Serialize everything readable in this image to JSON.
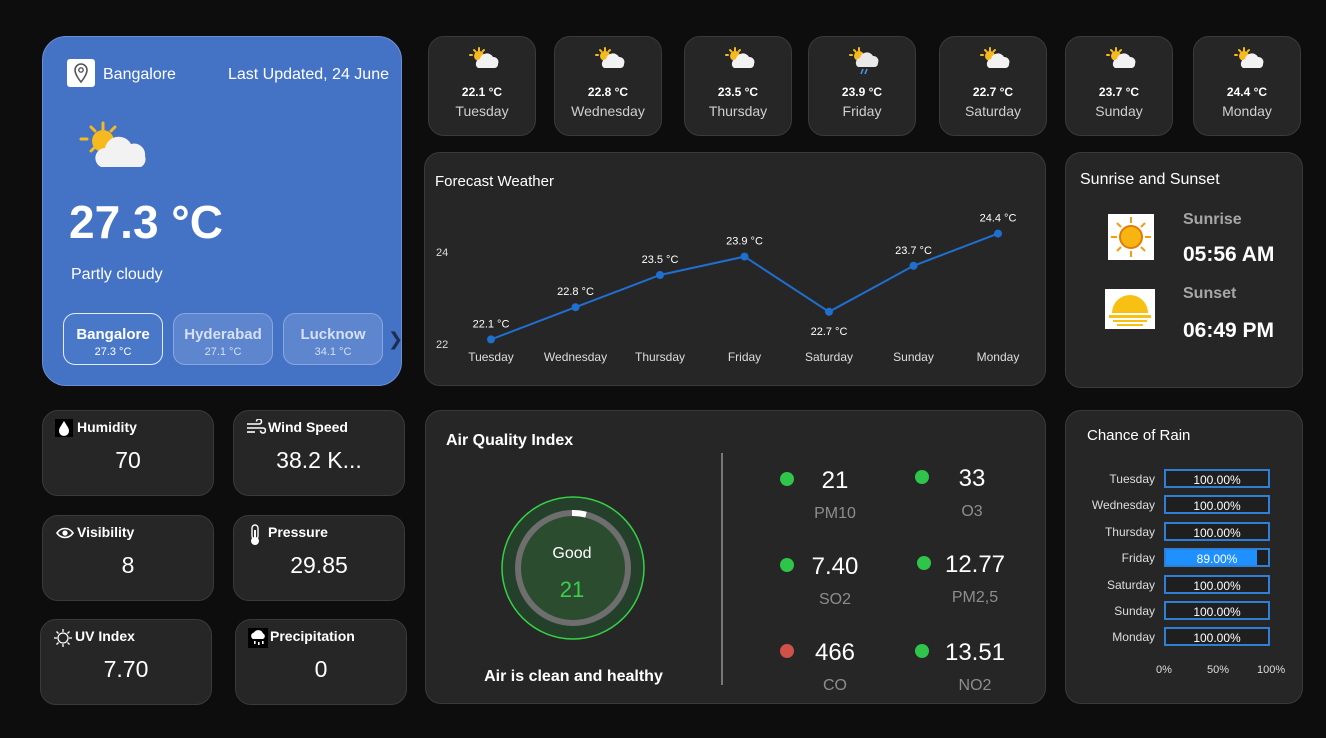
{
  "location": {
    "city": "Bangalore",
    "last_updated": "Last Updated, 24 June",
    "temperature": "27.3 °C",
    "condition": "Partly cloudy",
    "icon": "partly-cloudy-icon"
  },
  "cities": [
    {
      "name": "Bangalore",
      "temp": "27.3 °C",
      "active": true
    },
    {
      "name": "Hyderabad",
      "temp": "27.1 °C",
      "active": false
    },
    {
      "name": "Lucknow",
      "temp": "34.1 °C",
      "active": false
    }
  ],
  "daily": [
    {
      "day": "Tuesday",
      "temp": "22.1 °C",
      "icon": "partly-cloudy-icon"
    },
    {
      "day": "Wednesday",
      "temp": "22.8 °C",
      "icon": "partly-cloudy-icon"
    },
    {
      "day": "Thursday",
      "temp": "23.5 °C",
      "icon": "partly-cloudy-icon"
    },
    {
      "day": "Friday",
      "temp": "23.9 °C",
      "icon": "rain-icon"
    },
    {
      "day": "Saturday",
      "temp": "22.7 °C",
      "icon": "partly-cloudy-icon"
    },
    {
      "day": "Sunday",
      "temp": "23.7 °C",
      "icon": "partly-cloudy-icon"
    },
    {
      "day": "Monday",
      "temp": "24.4 °C",
      "icon": "partly-cloudy-icon"
    }
  ],
  "forecast": {
    "title": "Forecast Weather"
  },
  "chart_data": {
    "type": "line",
    "title": "Forecast Weather",
    "categories": [
      "Tuesday",
      "Wednesday",
      "Thursday",
      "Friday",
      "Saturday",
      "Sunday",
      "Monday"
    ],
    "values": [
      22.1,
      22.8,
      23.5,
      23.9,
      22.7,
      23.7,
      24.4
    ],
    "data_labels": [
      "22.1 °C",
      "22.8 °C",
      "23.5 °C",
      "23.9 °C",
      "22.7 °C",
      "23.7 °C",
      "24.4 °C"
    ],
    "yticks": [
      "22",
      "24"
    ],
    "ylim": [
      21.95,
      24.7
    ],
    "grid": false,
    "line_color": "#1f6fd1"
  },
  "sun": {
    "title": "Sunrise and Sunset",
    "sunrise_label": "Sunrise",
    "sunrise_time": "05:56 AM",
    "sunset_label": "Sunset",
    "sunset_time": "06:49 PM"
  },
  "metrics": {
    "humidity": {
      "label": "Humidity",
      "value": "70",
      "icon": "humidity-icon"
    },
    "wind": {
      "label": "Wind Speed",
      "value": "38.2 K...",
      "icon": "wind-icon"
    },
    "visibility": {
      "label": "Visibility",
      "value": "8",
      "icon": "eye-icon"
    },
    "pressure": {
      "label": "Pressure",
      "value": "29.85",
      "icon": "thermometer-icon"
    },
    "uv": {
      "label": "UV Index",
      "value": "7.70",
      "icon": "uv-icon"
    },
    "precipitation": {
      "label": "Precipitation",
      "value": "0",
      "icon": "precipitation-icon"
    }
  },
  "aqi": {
    "title": "Air Quality Index",
    "status": "Good",
    "value": "21",
    "description": "Air is clean and healthy",
    "pollutants": [
      {
        "value": "21",
        "name": "PM10",
        "status_color": "#2fc44a"
      },
      {
        "value": "33",
        "name": "O3",
        "status_color": "#2fc44a"
      },
      {
        "value": "7.40",
        "name": "SO2",
        "status_color": "#2fc44a"
      },
      {
        "value": "12.77",
        "name": "PM2,5",
        "status_color": "#2fc44a"
      },
      {
        "value": "466",
        "name": "CO",
        "status_color": "#d0504a"
      },
      {
        "value": "13.51",
        "name": "NO2",
        "status_color": "#2fc44a"
      }
    ]
  },
  "rain": {
    "title": "Chance of Rain",
    "days": [
      {
        "day": "Tuesday",
        "pct": "100.00%",
        "fraction": 1.0
      },
      {
        "day": "Wednesday",
        "pct": "100.00%",
        "fraction": 1.0
      },
      {
        "day": "Thursday",
        "pct": "100.00%",
        "fraction": 1.0
      },
      {
        "day": "Friday",
        "pct": "89.00%",
        "fraction": 0.89
      },
      {
        "day": "Saturday",
        "pct": "100.00%",
        "fraction": 1.0
      },
      {
        "day": "Sunday",
        "pct": "100.00%",
        "fraction": 1.0
      },
      {
        "day": "Monday",
        "pct": "100.00%",
        "fraction": 1.0
      }
    ],
    "axis": [
      "0%",
      "50%",
      "100%"
    ]
  },
  "colors": {
    "accent": "#4472c4",
    "card": "#262626",
    "good": "#2fc44a",
    "bad": "#d0504a",
    "bar": "#1e90ff"
  }
}
